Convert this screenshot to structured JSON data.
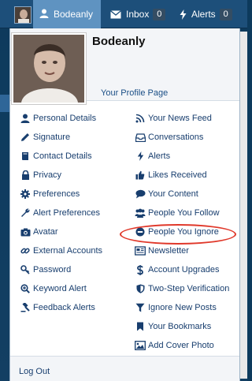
{
  "topbar": {
    "username": "Bodeanly",
    "inbox_label": "Inbox",
    "inbox_count": "0",
    "alerts_label": "Alerts",
    "alerts_count": "0"
  },
  "dropdown": {
    "username": "Bodeanly",
    "profile_link": "Your Profile Page",
    "left_items": [
      {
        "label": "Personal Details",
        "icon": "user-icon"
      },
      {
        "label": "Signature",
        "icon": "pencil-icon"
      },
      {
        "label": "Contact Details",
        "icon": "book-icon"
      },
      {
        "label": "Privacy",
        "icon": "lock-icon"
      },
      {
        "label": "Preferences",
        "icon": "gear-icon"
      },
      {
        "label": "Alert Preferences",
        "icon": "wrench-icon"
      },
      {
        "label": "Avatar",
        "icon": "camera-icon"
      },
      {
        "label": "External Accounts",
        "icon": "link-icon"
      },
      {
        "label": "Password",
        "icon": "key-icon"
      },
      {
        "label": "Keyword Alert",
        "icon": "search-plus-icon"
      },
      {
        "label": "Feedback Alerts",
        "icon": "gavel-icon"
      }
    ],
    "right_items": [
      {
        "label": "Your News Feed",
        "icon": "rss-icon"
      },
      {
        "label": "Conversations",
        "icon": "inbox-icon"
      },
      {
        "label": "Alerts",
        "icon": "bolt-icon"
      },
      {
        "label": "Likes Received",
        "icon": "thumbs-up-icon"
      },
      {
        "label": "Your Content",
        "icon": "comments-icon"
      },
      {
        "label": "People You Follow",
        "icon": "users-icon"
      },
      {
        "label": "People You Ignore",
        "icon": "minus-circle-icon"
      },
      {
        "label": "Newsletter",
        "icon": "newspaper-icon"
      },
      {
        "label": "Account Upgrades",
        "icon": "dollar-icon"
      },
      {
        "label": "Two-Step Verification",
        "icon": "shield-icon"
      },
      {
        "label": "Ignore New Posts",
        "icon": "filter-icon"
      },
      {
        "label": "Your Bookmarks",
        "icon": "bookmark-icon"
      },
      {
        "label": "Add Cover Photo",
        "icon": "image-icon"
      }
    ],
    "logout": "Log Out"
  },
  "colors": {
    "nav_bg": "#1d4f7a",
    "nav_active": "#5f93c1",
    "link": "#183e6e",
    "highlight": "#e0382a"
  }
}
